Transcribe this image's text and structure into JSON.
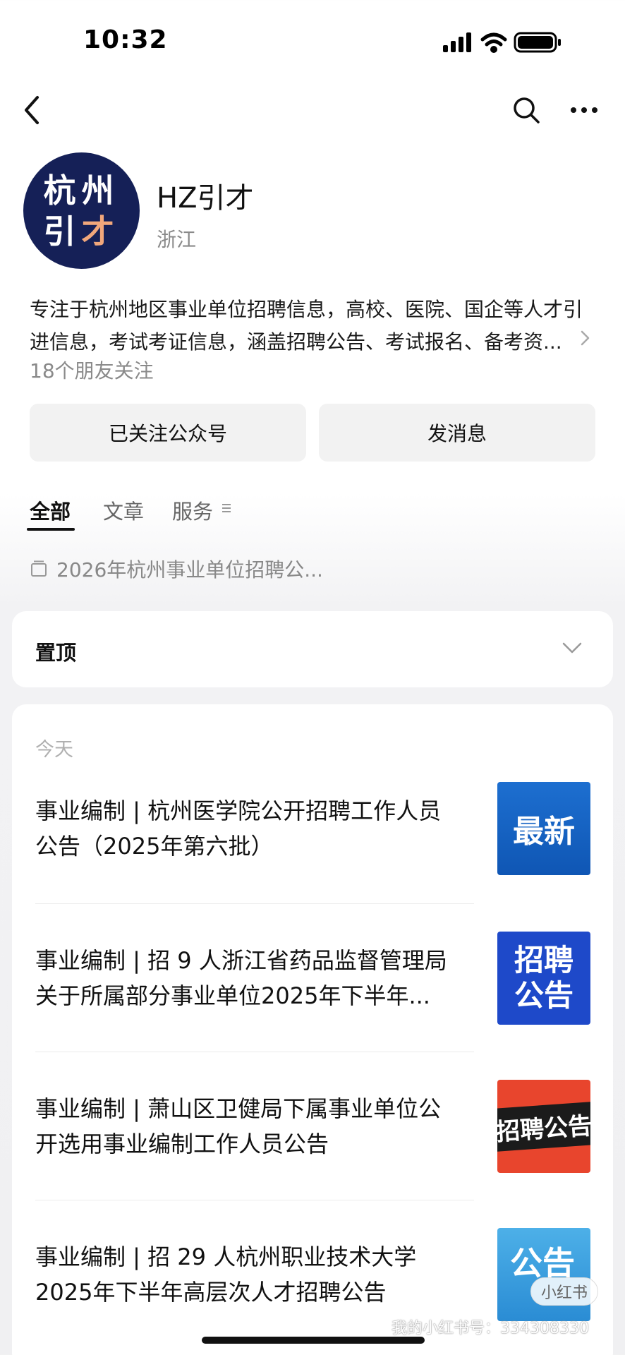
{
  "status_bar": {
    "time": "10:32"
  },
  "account": {
    "avatar_line1": "杭州",
    "avatar_line2_a": "引",
    "avatar_line2_b": "才",
    "name": "HZ引才",
    "location": "浙江",
    "description_line1": "专注于杭州地区事业单位招聘信息，高校、医院、国企等人才引",
    "description_line2": "进信息，考试考证信息，涵盖招聘公告、考试报名、备考资...",
    "followers": "18个朋友关注",
    "follow_button": "已关注公众号",
    "message_button": "发消息"
  },
  "tabs": [
    {
      "label": "全部",
      "active": true
    },
    {
      "label": "文章",
      "active": false
    },
    {
      "label": "服务",
      "active": false
    }
  ],
  "collection": {
    "label": "2026年杭州事业单位招聘公..."
  },
  "pinned": {
    "label": "置顶"
  },
  "list": {
    "section_label": "今天",
    "articles": [
      {
        "line1": "事业编制 | 杭州医学院公开招聘工作人员",
        "line2": "公告（2025年第六批）",
        "thumb_text": "最新"
      },
      {
        "line1": "事业编制 | 招 9 人浙江省药品监督管理局",
        "line2": "关于所属部分事业单位2025年下半年...",
        "thumb_text_1": "招聘",
        "thumb_text_2": "公告"
      },
      {
        "line1": "事业编制 | 萧山区卫健局下属事业单位公",
        "line2": "开选用事业编制工作人员公告",
        "thumb_text": "招聘公告"
      },
      {
        "line1": "事业编制 | 招 29 人杭州职业技术大学",
        "line2": "2025年下半年高层次人才招聘公告",
        "thumb_text": "公告"
      }
    ]
  },
  "watermark": {
    "badge": "小红书",
    "text": "我的小红书号：334308330"
  },
  "icons": [
    "back-icon",
    "search-icon",
    "more-icon",
    "chevron-right-icon",
    "menu-icon",
    "collection-icon",
    "chevron-down-icon"
  ]
}
